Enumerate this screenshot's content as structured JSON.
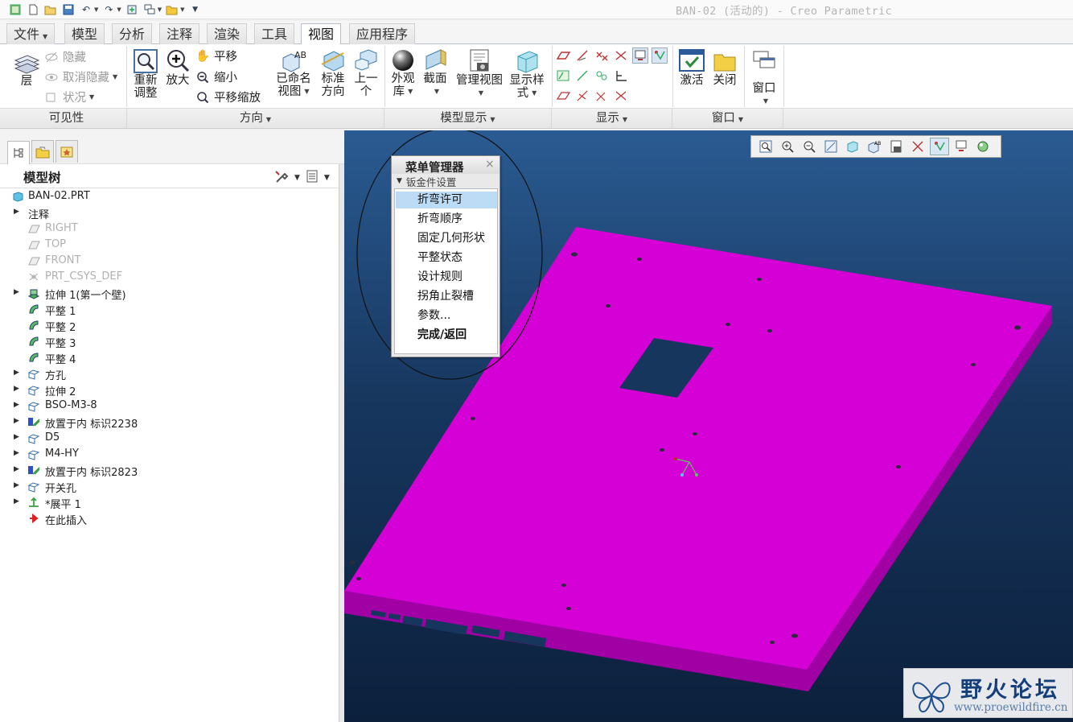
{
  "window": {
    "title": "BAN-02 (活动的) - Creo Parametric"
  },
  "quick_access": {
    "icons": [
      "app-icon",
      "new-icon",
      "open-icon",
      "save-icon",
      "undo-icon",
      "redo-icon",
      "regenerate-icon",
      "windows-icon",
      "folder-icon",
      "customize-icon"
    ]
  },
  "tabs": [
    "文件",
    "模型",
    "分析",
    "注释",
    "渲染",
    "工具",
    "视图",
    "应用程序"
  ],
  "active_tab": "视图",
  "ribbon": {
    "visibility": {
      "layer": "层",
      "hide": "隐藏",
      "unhide": "取消隐藏",
      "status": "状况",
      "group": "可见性"
    },
    "orientation": {
      "refit": [
        "重新",
        "调整"
      ],
      "zoom_in": "放大",
      "pan": "平移",
      "zoom_out": "缩小",
      "pan_zoom": "平移缩放",
      "named_views": [
        "已命名",
        "视图"
      ],
      "standard_orient": [
        "标准",
        "方向"
      ],
      "previous": [
        "上一",
        "个"
      ],
      "group": "方向"
    },
    "model_display": {
      "appearance": [
        "外观",
        "库"
      ],
      "section": "截面",
      "manage_views": "管理视图",
      "display_style": [
        "显示样",
        "式"
      ],
      "group": "模型显示"
    },
    "show": {
      "group": "显示"
    },
    "window": {
      "activate": "激活",
      "close": "关闭",
      "windows": "窗口",
      "group": "窗口"
    }
  },
  "model_tree": {
    "title": "模型树",
    "root": "BAN-02.PRT",
    "nodes": [
      {
        "label": "注释",
        "expand": true,
        "icon": "none",
        "dim": false
      },
      {
        "label": "RIGHT",
        "expand": false,
        "icon": "datum-plane-icon",
        "dim": true
      },
      {
        "label": "TOP",
        "expand": false,
        "icon": "datum-plane-icon",
        "dim": true
      },
      {
        "label": "FRONT",
        "expand": false,
        "icon": "datum-plane-icon",
        "dim": true
      },
      {
        "label": "PRT_CSYS_DEF",
        "expand": false,
        "icon": "csys-icon",
        "dim": true
      },
      {
        "label": "拉伸 1(第一个壁)",
        "expand": true,
        "icon": "first-wall-icon",
        "dim": false
      },
      {
        "label": "平整 1",
        "expand": false,
        "icon": "flat-wall-icon",
        "dim": false
      },
      {
        "label": "平整 2",
        "expand": false,
        "icon": "flat-wall-icon",
        "dim": false
      },
      {
        "label": "平整 3",
        "expand": false,
        "icon": "flat-wall-icon",
        "dim": false
      },
      {
        "label": "平整 4",
        "expand": false,
        "icon": "flat-wall-icon",
        "dim": false
      },
      {
        "label": "方孔",
        "expand": true,
        "icon": "cut-icon",
        "dim": false
      },
      {
        "label": "拉伸 2",
        "expand": true,
        "icon": "cut-icon",
        "dim": false
      },
      {
        "label": "BSO-M3-8",
        "expand": true,
        "icon": "cut-icon",
        "dim": false
      },
      {
        "label": "放置于内 标识2238",
        "expand": true,
        "icon": "form-icon",
        "dim": false
      },
      {
        "label": "D5",
        "expand": true,
        "icon": "cut-icon",
        "dim": false
      },
      {
        "label": "M4-HY",
        "expand": true,
        "icon": "cut-icon",
        "dim": false
      },
      {
        "label": "放置于内 标识2823",
        "expand": true,
        "icon": "form-icon",
        "dim": false
      },
      {
        "label": "开关孔",
        "expand": true,
        "icon": "cut-icon",
        "dim": false
      },
      {
        "label": "*展平 1",
        "expand": true,
        "icon": "unbend-icon",
        "dim": false
      },
      {
        "label": "在此插入",
        "expand": false,
        "icon": "insert-here-icon",
        "dim": false
      }
    ]
  },
  "menu_manager": {
    "title": "菜单管理器",
    "close": "×",
    "submenu": "钣金件设置",
    "items": [
      "折弯许可",
      "折弯顺序",
      "固定几何形状",
      "平整状态",
      "设计规则",
      "拐角止裂槽",
      "参数...",
      "完成/返回"
    ],
    "selected": "折弯许可"
  },
  "watermark": {
    "name": "野火论坛",
    "url": "www.proewildfire.cn"
  },
  "colors": {
    "model": "#d400d6",
    "model_side": "#a000a4",
    "background_top": "#2a5b92",
    "background_bottom": "#0c203c",
    "menu_selected": "#bcdcf6"
  }
}
